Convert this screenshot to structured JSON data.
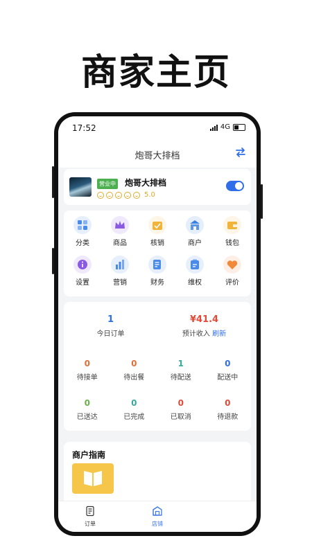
{
  "headline": "商家主页",
  "status_bar": {
    "time": "17:52",
    "network": "4G"
  },
  "nav": {
    "title": "炮哥大排档"
  },
  "shop": {
    "status_badge": "营业中",
    "name": "炮哥大排档",
    "rating": "5.0",
    "open": true
  },
  "menu": [
    {
      "label": "分类",
      "icon": "category-icon",
      "color": "#4a8ae8"
    },
    {
      "label": "商品",
      "icon": "crown-icon",
      "color": "#8a5be0"
    },
    {
      "label": "核销",
      "icon": "calendar-check-icon",
      "color": "#f1b43a"
    },
    {
      "label": "商户",
      "icon": "store-icon",
      "color": "#3b82e0"
    },
    {
      "label": "钱包",
      "icon": "wallet-icon",
      "color": "#f1b43a"
    },
    {
      "label": "设置",
      "icon": "info-icon",
      "color": "#8a5be0"
    },
    {
      "label": "营销",
      "icon": "bar-chart-icon",
      "color": "#4a8ae8"
    },
    {
      "label": "财务",
      "icon": "document-icon",
      "color": "#4a8ae8"
    },
    {
      "label": "维权",
      "icon": "clipboard-icon",
      "color": "#4a8ae8"
    },
    {
      "label": "评价",
      "icon": "heart-icon",
      "color": "#f08a3a"
    }
  ],
  "stats": {
    "today_orders": {
      "value": "1",
      "label": "今日订单"
    },
    "expected_income": {
      "value": "¥41.4",
      "label": "预计收入",
      "refresh": "刷新"
    },
    "grid": [
      {
        "value": "0",
        "label": "待接单",
        "color": "#e0703a"
      },
      {
        "value": "0",
        "label": "待出餐",
        "color": "#e0703a"
      },
      {
        "value": "1",
        "label": "待配送",
        "color": "#3aa89a"
      },
      {
        "value": "0",
        "label": "配送中",
        "color": "#2f6ee8"
      },
      {
        "value": "0",
        "label": "已送达",
        "color": "#6ab04c"
      },
      {
        "value": "0",
        "label": "已完成",
        "color": "#3aa89a"
      },
      {
        "value": "0",
        "label": "已取消",
        "color": "#e04a3a"
      },
      {
        "value": "0",
        "label": "待退款",
        "color": "#e04a3a"
      }
    ]
  },
  "guide": {
    "title": "商户指南"
  },
  "tabs": [
    {
      "label": "订单",
      "active": false
    },
    {
      "label": "店铺",
      "active": true
    }
  ],
  "colors": {
    "accent": "#2f6ee8",
    "income": "#e04a3a",
    "order_count": "#2f6ee8"
  }
}
